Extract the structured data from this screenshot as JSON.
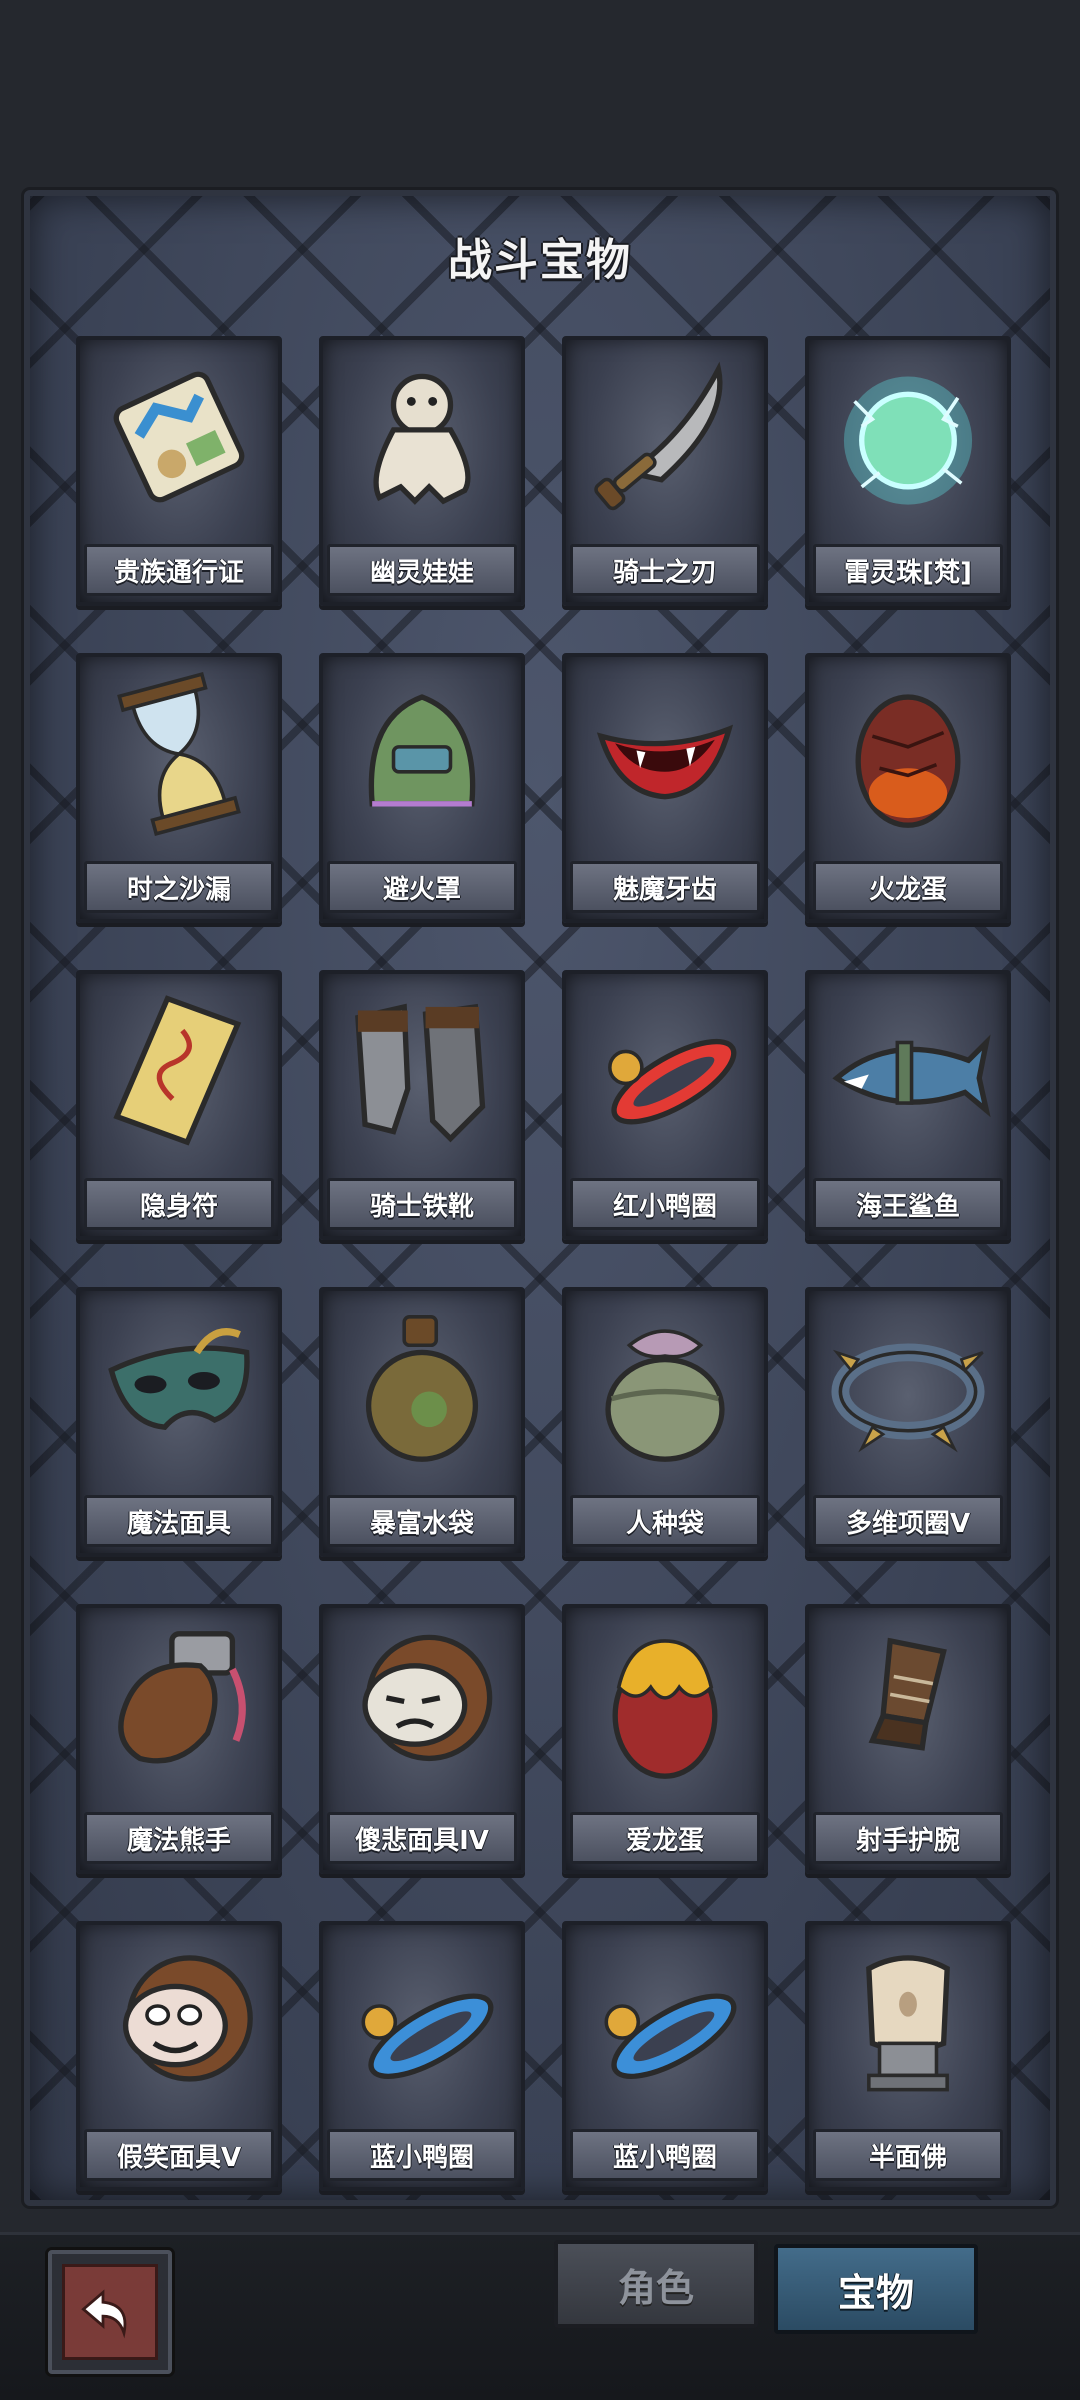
{
  "panel": {
    "title": "战斗宝物",
    "items": [
      {
        "label": "贵族通行证",
        "icon": "pass-card-icon"
      },
      {
        "label": "幽灵娃娃",
        "icon": "ghost-doll-icon"
      },
      {
        "label": "骑士之刃",
        "icon": "knight-blade-icon"
      },
      {
        "label": "雷灵珠[梵]",
        "icon": "thunder-orb-icon"
      },
      {
        "label": "时之沙漏",
        "icon": "hourglass-icon"
      },
      {
        "label": "避火罩",
        "icon": "fire-mask-icon"
      },
      {
        "label": "魅魔牙齿",
        "icon": "fangs-lips-icon"
      },
      {
        "label": "火龙蛋",
        "icon": "fire-dragon-egg-icon"
      },
      {
        "label": "隐身符",
        "icon": "stealth-talisman-icon"
      },
      {
        "label": "骑士铁靴",
        "icon": "knight-boots-icon"
      },
      {
        "label": "红小鸭圈",
        "icon": "red-duck-ring-icon"
      },
      {
        "label": "海王鲨鱼",
        "icon": "shark-icon"
      },
      {
        "label": "魔法面具",
        "icon": "magic-mask-icon"
      },
      {
        "label": "暴富水袋",
        "icon": "water-pouch-icon"
      },
      {
        "label": "人种袋",
        "icon": "seed-bag-icon"
      },
      {
        "label": "多维项圈V",
        "icon": "collar-icon"
      },
      {
        "label": "魔法熊手",
        "icon": "bear-paw-icon"
      },
      {
        "label": "傻悲面具IV",
        "icon": "sad-mask-icon"
      },
      {
        "label": "爱龙蛋",
        "icon": "love-dragon-egg-icon"
      },
      {
        "label": "射手护腕",
        "icon": "archer-bracer-icon"
      },
      {
        "label": "假笑面具V",
        "icon": "fake-smile-mask-icon"
      },
      {
        "label": "蓝小鸭圈",
        "icon": "blue-duck-ring-icon"
      },
      {
        "label": "蓝小鸭圈",
        "icon": "blue-duck-ring-icon"
      },
      {
        "label": "半面佛",
        "icon": "half-buddha-icon"
      }
    ]
  },
  "bottom_bar": {
    "back_icon": "back-arrow-icon",
    "tabs": [
      {
        "label": "角色",
        "active": false
      },
      {
        "label": "宝物",
        "active": true
      }
    ]
  },
  "colors": {
    "panel_bg": "#3d4559",
    "active_tab": "#436c8a",
    "back_button": "#7a3b38"
  }
}
